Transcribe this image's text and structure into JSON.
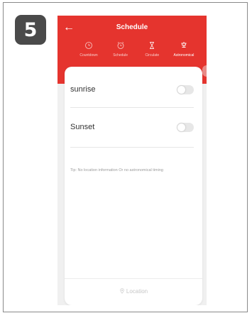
{
  "step_badge": "5",
  "header": {
    "title": "Schedule",
    "tabs": [
      {
        "label": "Countdown",
        "icon": "clock-icon",
        "active": false
      },
      {
        "label": "Schedule",
        "icon": "alarm-clock-icon",
        "active": false
      },
      {
        "label": "Circulate",
        "icon": "hourglass-icon",
        "active": false
      },
      {
        "label": "Astronomical",
        "icon": "lamp-icon",
        "active": true
      }
    ]
  },
  "settings": {
    "sunrise": {
      "label": "sunrise",
      "enabled": false
    },
    "sunset": {
      "label": "Sunset",
      "enabled": false
    },
    "tip": "Tip: No location information Or no astronomical timing"
  },
  "footer": {
    "location_label": "Location",
    "location_icon": "location-pin-icon"
  },
  "colors": {
    "header_red": "#e5342e",
    "toggle_off": "#e7e7e7",
    "badge": "#4a4a4a"
  }
}
